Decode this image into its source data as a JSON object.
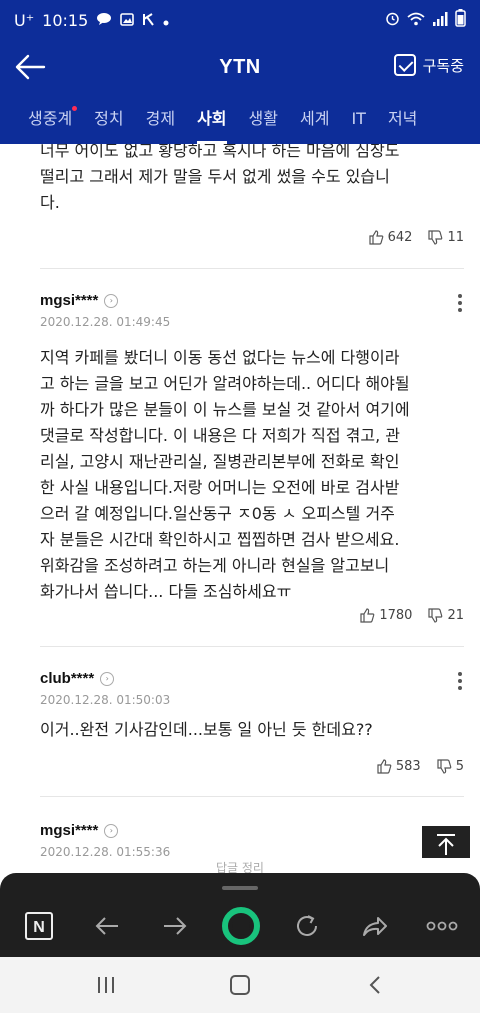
{
  "status_bar": {
    "carrier": "U⁺",
    "time": "10:15"
  },
  "header": {
    "title": "YTN",
    "subscribe_label": "구독중"
  },
  "tabs": [
    {
      "label": "생중계",
      "has_dot": true
    },
    {
      "label": "정치"
    },
    {
      "label": "경제"
    },
    {
      "label": "사회",
      "active": true
    },
    {
      "label": "생활"
    },
    {
      "label": "세계"
    },
    {
      "label": "IT"
    },
    {
      "label": "저녁"
    }
  ],
  "comments": [
    {
      "body_lines": [
        "너무 어이도 없고 황당하고 혹시나 하는 마음에 심장도",
        "떨리고 그래서 제가 말을 두서 없게 썼을 수도 있습니",
        "다."
      ],
      "likes": "642",
      "dislikes": "11"
    },
    {
      "user": "mgsi****",
      "date": "2020.12.28. 01:49:45",
      "body_lines": [
        "지역 카페를 봤더니 이동 동선 없다는 뉴스에 다행이라",
        "고 하는 글을 보고 어딘가 알려야하는데.. 어디다 해야될",
        "까 하다가 많은 분들이 이 뉴스를 보실 것 같아서 여기에",
        "댓글로 작성합니다. 이 내용은 다 저희가 직접 겪고, 관",
        "리실, 고양시 재난관리실, 질병관리본부에 전화로 확인",
        "한 사실 내용입니다.저랑 어머니는 오전에 바로 검사받",
        "으러 갈 예정입니다.일산동구 ㅈ0동 ㅅ 오피스텔 거주",
        "자 분들은 시간대 확인하시고 찝찝하면 검사 받으세요.",
        "위화감을 조성하려고 하는게 아니라 현실을 알고보니",
        "화가나서 씁니다... 다들 조심하세요ㅠ"
      ],
      "likes": "1780",
      "dislikes": "21"
    },
    {
      "user": "club****",
      "date": "2020.12.28. 01:50:03",
      "body_lines": [
        "이거..완전 기사감인데...보통 일 아닌 듯 한데요??"
      ],
      "likes": "583",
      "dislikes": "5"
    },
    {
      "user": "mgsi****",
      "date": "2020.12.28. 01:55:36"
    }
  ],
  "sheet_peek": "답글 정리",
  "browser_bar": {
    "n_label": "N"
  },
  "colors": {
    "brand": "#0d2d99",
    "accent_green": "#19c37d"
  }
}
